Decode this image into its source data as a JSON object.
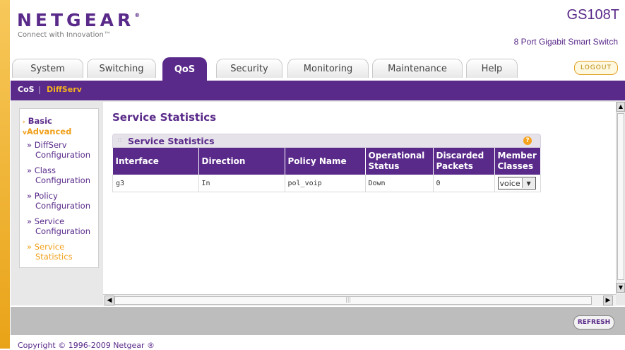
{
  "header": {
    "logo": "NETGEAR",
    "tagline": "Connect with Innovation™",
    "model": "GS108T",
    "subtitle": "8 Port Gigabit Smart Switch",
    "logout_label": "LOGOUT"
  },
  "tabs": [
    {
      "label": "System"
    },
    {
      "label": "Switching"
    },
    {
      "label": "QoS"
    },
    {
      "label": "Security"
    },
    {
      "label": "Monitoring"
    },
    {
      "label": "Maintenance"
    },
    {
      "label": "Help"
    }
  ],
  "subnav": {
    "item1": "CoS",
    "separator": "|",
    "item2": "DiffServ"
  },
  "sidebar": {
    "basic": "Basic",
    "advanced": "Advanced",
    "items": [
      {
        "line1": "» DiffServ",
        "line2": "Configuration"
      },
      {
        "line1": "» Class",
        "line2": "Configuration"
      },
      {
        "line1": "» Policy",
        "line2": "Configuration"
      },
      {
        "line1": "» Service",
        "line2": "Configuration"
      },
      {
        "line1": "» Service",
        "line2": "Statistics"
      }
    ]
  },
  "main": {
    "page_title": "Service Statistics",
    "panel_title": "Service Statistics",
    "columns": [
      "Interface",
      "Direction",
      "Policy Name",
      "Operational Status",
      "Discarded Packets",
      "Member Classes"
    ],
    "col_headers": {
      "interface": "Interface",
      "direction": "Direction",
      "policy_name": "Policy Name",
      "op1": "Operational",
      "op2": "Status",
      "disc1": "Discarded",
      "disc2": "Packets",
      "mem1": "Member",
      "mem2": "Classes"
    },
    "rows": [
      {
        "interface": "g3",
        "direction": "In",
        "policy_name": "pol_voip",
        "status": "Down",
        "discarded": "0",
        "member_class": "voice"
      }
    ]
  },
  "footer": {
    "refresh_label": "REFRESH",
    "copyright": "Copyright © 1996-2009 Netgear ®"
  },
  "colors": {
    "brand_purple": "#5a2a8a",
    "accent_orange": "#f0a01a"
  }
}
